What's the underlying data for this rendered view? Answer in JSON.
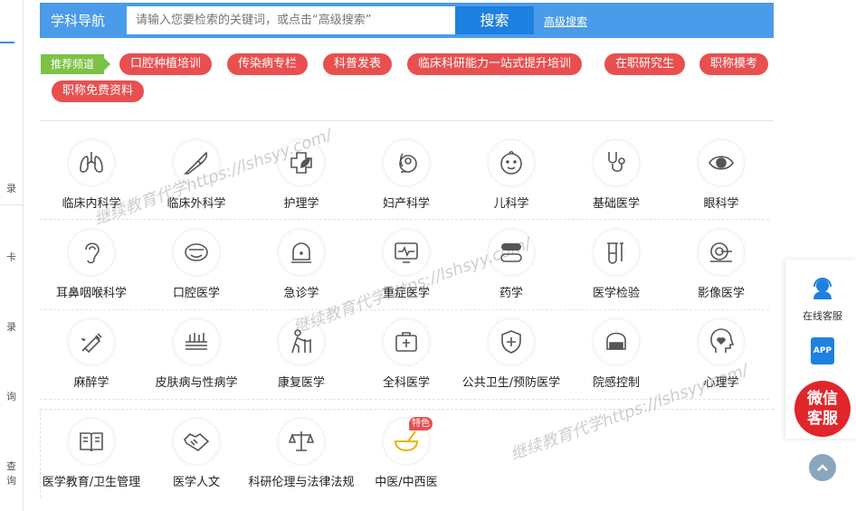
{
  "left_rail": {
    "items": [
      "录",
      "卡",
      "录",
      "询",
      "查询"
    ]
  },
  "header": {
    "title": "学科导航",
    "search_placeholder": "请输入您要检索的关键词，或点击“高级搜索”",
    "search_button": "搜索",
    "advanced_link": "高级搜索"
  },
  "recommend": {
    "label": "推荐频道",
    "tags": [
      "口腔种植培训",
      "传染病专栏",
      "科普发表",
      "临床科研能力一站式提升培训",
      "在职研究生",
      "职称模考",
      "职称免费资料"
    ]
  },
  "subjects": [
    {
      "label": "临床内科学",
      "icon": "lungs-icon"
    },
    {
      "label": "临床外科学",
      "icon": "scalpel-icon"
    },
    {
      "label": "护理学",
      "icon": "cross-leaf-icon"
    },
    {
      "label": "妇产科学",
      "icon": "pregnancy-icon"
    },
    {
      "label": "儿科学",
      "icon": "baby-face-icon"
    },
    {
      "label": "基础医学",
      "icon": "stethoscope-icon"
    },
    {
      "label": "眼科学",
      "icon": "eye-icon"
    },
    {
      "label": "耳鼻咽喉科学",
      "icon": "ear-icon"
    },
    {
      "label": "口腔医学",
      "icon": "mouth-icon"
    },
    {
      "label": "急诊学",
      "icon": "siren-icon"
    },
    {
      "label": "重症医学",
      "icon": "monitor-icon"
    },
    {
      "label": "药学",
      "icon": "pills-icon"
    },
    {
      "label": "医学检验",
      "icon": "test-tube-icon"
    },
    {
      "label": "影像医学",
      "icon": "scanner-icon"
    },
    {
      "label": "麻醉学",
      "icon": "syringe-icon"
    },
    {
      "label": "皮肤病与性病学",
      "icon": "skin-icon"
    },
    {
      "label": "康复医学",
      "icon": "walker-icon"
    },
    {
      "label": "全科医学",
      "icon": "medical-kit-icon"
    },
    {
      "label": "公共卫生/预防医学",
      "icon": "shield-cross-icon"
    },
    {
      "label": "院感控制",
      "icon": "mask-icon"
    },
    {
      "label": "心理学",
      "icon": "head-heart-icon"
    },
    {
      "label": "医学教育/卫生管理",
      "icon": "book-icon"
    },
    {
      "label": "医学人文",
      "icon": "handshake-icon"
    },
    {
      "label": "科研伦理与法律法规",
      "icon": "scales-icon"
    },
    {
      "label": "中医/中西医",
      "icon": "mortar-icon"
    }
  ],
  "special_badge": "特色",
  "side_panel": {
    "service_label": "在线客服",
    "app_label": "APP",
    "wechat_line1": "微信",
    "wechat_line2": "客服"
  },
  "watermark": "继续教育代学https://lshsyy.com/"
}
